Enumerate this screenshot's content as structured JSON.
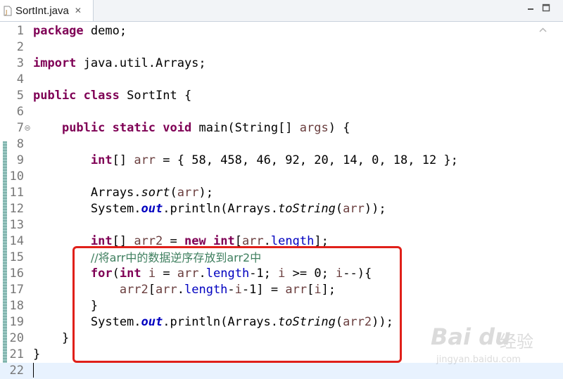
{
  "tab": {
    "label": "SortInt.java",
    "close": "✕"
  },
  "editor": {
    "lines": [
      {
        "n": "1",
        "tokens": [
          {
            "t": "package",
            "c": "kw"
          },
          {
            "t": " demo;"
          }
        ]
      },
      {
        "n": "2",
        "tokens": []
      },
      {
        "n": "3",
        "tokens": [
          {
            "t": "import",
            "c": "kw"
          },
          {
            "t": " java.util.Arrays;"
          }
        ]
      },
      {
        "n": "4",
        "tokens": []
      },
      {
        "n": "5",
        "tokens": [
          {
            "t": "public",
            "c": "kw"
          },
          {
            "t": " "
          },
          {
            "t": "class",
            "c": "kw"
          },
          {
            "t": " SortInt {"
          }
        ]
      },
      {
        "n": "6",
        "tokens": []
      },
      {
        "n": "7",
        "fold": true,
        "tokens": [
          {
            "t": "    "
          },
          {
            "t": "public",
            "c": "kw"
          },
          {
            "t": " "
          },
          {
            "t": "static",
            "c": "kw"
          },
          {
            "t": " "
          },
          {
            "t": "void",
            "c": "kw"
          },
          {
            "t": " main(String[] "
          },
          {
            "t": "args",
            "c": "id"
          },
          {
            "t": ") {"
          }
        ]
      },
      {
        "n": "8",
        "tokens": []
      },
      {
        "n": "9",
        "tokens": [
          {
            "t": "        "
          },
          {
            "t": "int",
            "c": "kw"
          },
          {
            "t": "[] "
          },
          {
            "t": "arr",
            "c": "id"
          },
          {
            "t": " = { 58, 458, 46, 92, 20, 14, 0, 18, 12 };"
          }
        ]
      },
      {
        "n": "10",
        "tokens": []
      },
      {
        "n": "11",
        "tokens": [
          {
            "t": "        Arrays."
          },
          {
            "t": "sort",
            "c": "smth"
          },
          {
            "t": "("
          },
          {
            "t": "arr",
            "c": "id"
          },
          {
            "t": ");"
          }
        ]
      },
      {
        "n": "12",
        "tokens": [
          {
            "t": "        System."
          },
          {
            "t": "out",
            "c": "sfld"
          },
          {
            "t": ".println(Arrays."
          },
          {
            "t": "toString",
            "c": "smth"
          },
          {
            "t": "("
          },
          {
            "t": "arr",
            "c": "id"
          },
          {
            "t": "));"
          }
        ]
      },
      {
        "n": "13",
        "tokens": []
      },
      {
        "n": "14",
        "tokens": [
          {
            "t": "        "
          },
          {
            "t": "int",
            "c": "kw"
          },
          {
            "t": "[] "
          },
          {
            "t": "arr2",
            "c": "id"
          },
          {
            "t": " = "
          },
          {
            "t": "new",
            "c": "kw"
          },
          {
            "t": " "
          },
          {
            "t": "int",
            "c": "kw"
          },
          {
            "t": "["
          },
          {
            "t": "arr",
            "c": "id"
          },
          {
            "t": "."
          },
          {
            "t": "length",
            "c": "fld"
          },
          {
            "t": "];"
          }
        ]
      },
      {
        "n": "15",
        "tokens": [
          {
            "t": "        "
          },
          {
            "t": "//将arr中的数据逆序存放到arr2中",
            "c": "cm"
          }
        ]
      },
      {
        "n": "16",
        "tokens": [
          {
            "t": "        "
          },
          {
            "t": "for",
            "c": "kw"
          },
          {
            "t": "("
          },
          {
            "t": "int",
            "c": "kw"
          },
          {
            "t": " "
          },
          {
            "t": "i",
            "c": "id"
          },
          {
            "t": " = "
          },
          {
            "t": "arr",
            "c": "id"
          },
          {
            "t": "."
          },
          {
            "t": "length",
            "c": "fld"
          },
          {
            "t": "-1; "
          },
          {
            "t": "i",
            "c": "id"
          },
          {
            "t": " >= 0; "
          },
          {
            "t": "i",
            "c": "id"
          },
          {
            "t": "--){"
          }
        ]
      },
      {
        "n": "17",
        "tokens": [
          {
            "t": "            "
          },
          {
            "t": "arr2",
            "c": "id"
          },
          {
            "t": "["
          },
          {
            "t": "arr",
            "c": "id"
          },
          {
            "t": "."
          },
          {
            "t": "length",
            "c": "fld"
          },
          {
            "t": "-"
          },
          {
            "t": "i",
            "c": "id"
          },
          {
            "t": "-1] = "
          },
          {
            "t": "arr",
            "c": "id"
          },
          {
            "t": "["
          },
          {
            "t": "i",
            "c": "id"
          },
          {
            "t": "];"
          }
        ]
      },
      {
        "n": "18",
        "tokens": [
          {
            "t": "        }"
          }
        ]
      },
      {
        "n": "19",
        "tokens": [
          {
            "t": "        System."
          },
          {
            "t": "out",
            "c": "sfld"
          },
          {
            "t": ".println(Arrays."
          },
          {
            "t": "toString",
            "c": "smth"
          },
          {
            "t": "("
          },
          {
            "t": "arr2",
            "c": "id"
          },
          {
            "t": "));"
          }
        ]
      },
      {
        "n": "20",
        "tokens": [
          {
            "t": "    }"
          }
        ]
      },
      {
        "n": "21",
        "tokens": [
          {
            "t": "}"
          }
        ]
      },
      {
        "n": "22",
        "current": true,
        "tokens": []
      }
    ]
  },
  "colors": {
    "keyword": "#7f0055",
    "local_variable": "#6a3e3e",
    "field": "#0000c0",
    "comment": "#3f7f5f",
    "highlight_box": "#e0201a",
    "current_line": "#e8f2fe"
  },
  "watermark": {
    "logo": "Bai du",
    "cn": "经验",
    "url": "jingyan.baidu.com"
  }
}
